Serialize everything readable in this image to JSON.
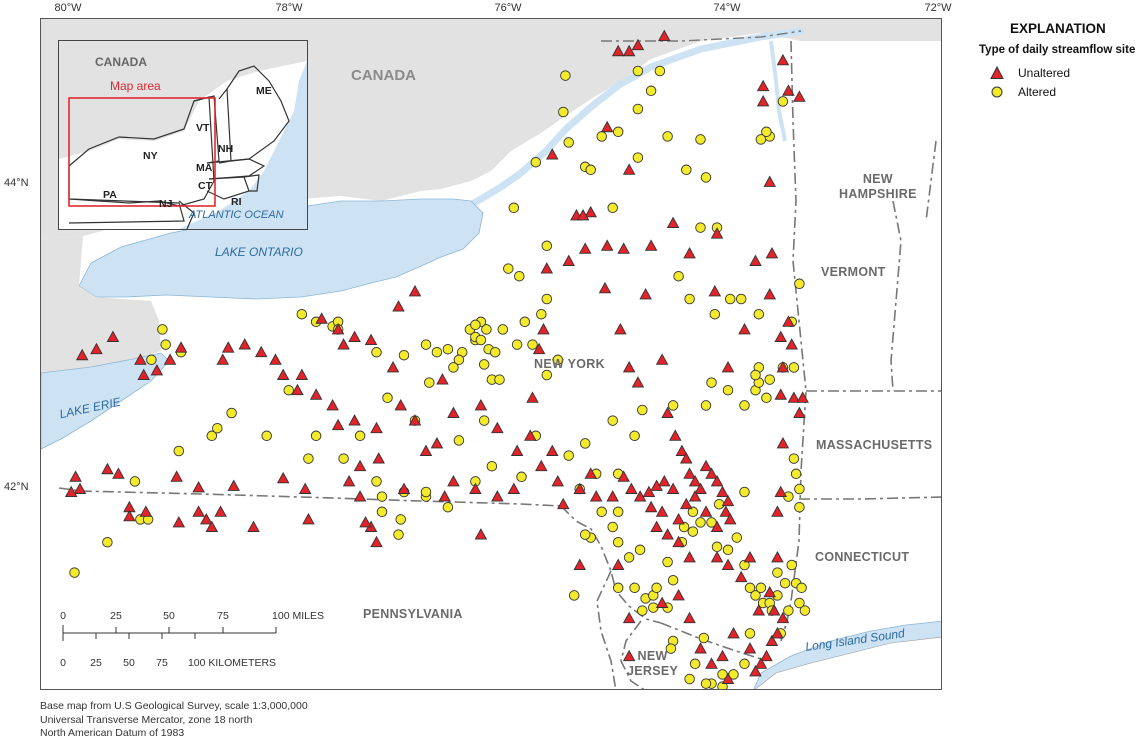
{
  "graticule": {
    "longitudes": [
      "80°W",
      "78°W",
      "76°W",
      "74°W",
      "72°W"
    ],
    "latitudes": [
      "44°N",
      "42°N"
    ]
  },
  "map_labels": {
    "canada": "CANADA",
    "new_york": "NEW YORK",
    "pennsylvania": "PENNSYLVANIA",
    "new_jersey_1": "NEW",
    "new_jersey_2": "JERSEY",
    "connecticut": "CONNECTICUT",
    "massachusetts": "MASSACHUSETTS",
    "vermont": "VERMONT",
    "new_hampshire_1": "NEW",
    "new_hampshire_2": "HAMPSHIRE",
    "lake_ontario": "LAKE ONTARIO",
    "lake_erie": "LAKE ERIE",
    "long_island_sound": "Long Island Sound"
  },
  "inset": {
    "canada": "CANADA",
    "map_area": "Map area",
    "me": "ME",
    "vt": "VT",
    "nh": "NH",
    "ny": "NY",
    "ma": "MA",
    "ct": "CT",
    "ri": "RI",
    "pa": "PA",
    "nj": "NJ",
    "ocean": "ATLANTIC OCEAN",
    "colors": {
      "map_area_box": "#e0282e"
    }
  },
  "legend": {
    "title": "EXPLANATION",
    "subtitle": "Type of daily streamflow site",
    "unaltered": "Unaltered",
    "altered": "Altered"
  },
  "scale_bar": {
    "miles_ticks": [
      "0",
      "25",
      "50",
      "75",
      "100 MILES"
    ],
    "km_ticks": [
      "0",
      "25",
      "50",
      "75",
      "100 KILOMETERS"
    ]
  },
  "credits": {
    "line1": "Base map from U.S Geological Survey, scale 1:3,000,000",
    "line2": "Universal Transverse Mercator, zone 18 north",
    "line3": "North American Datum of 1983"
  },
  "colors": {
    "water": "#cde3f4",
    "canada_land": "#e2e2e2",
    "unaltered": "#e2232a",
    "altered": "#f2ea2b",
    "marker_stroke": "#333333"
  },
  "sites": {
    "unaltered": [
      [
        -79.94,
        42.08
      ],
      [
        -79.9,
        42.0
      ],
      [
        -79.98,
        41.98
      ],
      [
        -79.65,
        42.13
      ],
      [
        -79.55,
        42.1
      ],
      [
        -79.45,
        41.88
      ],
      [
        -79.45,
        41.82
      ],
      [
        -79.3,
        41.85
      ],
      [
        -79.02,
        42.08
      ],
      [
        -79.0,
        41.78
      ],
      [
        -78.82,
        42.01
      ],
      [
        -78.82,
        41.85
      ],
      [
        -78.75,
        41.8
      ],
      [
        -78.7,
        41.75
      ],
      [
        -78.62,
        41.85
      ],
      [
        -78.5,
        42.02
      ],
      [
        -78.32,
        41.75
      ],
      [
        -78.05,
        42.07
      ],
      [
        -78.6,
        42.85
      ],
      [
        -78.55,
        42.93
      ],
      [
        -78.4,
        42.95
      ],
      [
        -78.25,
        42.9
      ],
      [
        -78.12,
        42.85
      ],
      [
        -78.05,
        42.75
      ],
      [
        -77.92,
        42.65
      ],
      [
        -77.88,
        42.75
      ],
      [
        -77.75,
        42.62
      ],
      [
        -77.6,
        42.55
      ],
      [
        -77.55,
        42.42
      ],
      [
        -77.4,
        42.45
      ],
      [
        -77.2,
        42.4
      ],
      [
        -77.18,
        42.2
      ],
      [
        -77.35,
        42.15
      ],
      [
        -77.45,
        42.05
      ],
      [
        -77.35,
        41.95
      ],
      [
        -78.98,
        42.93
      ],
      [
        -79.08,
        42.85
      ],
      [
        -79.2,
        42.78
      ],
      [
        -79.35,
        42.85
      ],
      [
        -79.32,
        42.75
      ],
      [
        -79.6,
        43.0
      ],
      [
        -79.75,
        42.92
      ],
      [
        -79.88,
        42.88
      ],
      [
        -77.7,
        43.12
      ],
      [
        -77.55,
        43.05
      ],
      [
        -77.5,
        42.95
      ],
      [
        -77.4,
        43.0
      ],
      [
        -77.25,
        42.98
      ],
      [
        -77.0,
        43.2
      ],
      [
        -76.85,
        43.3
      ],
      [
        -77.05,
        42.8
      ],
      [
        -76.98,
        42.55
      ],
      [
        -76.85,
        42.45
      ],
      [
        -76.75,
        42.25
      ],
      [
        -76.65,
        42.3
      ],
      [
        -76.5,
        42.05
      ],
      [
        -76.3,
        42.0
      ],
      [
        -76.1,
        41.95
      ],
      [
        -75.92,
        42.25
      ],
      [
        -75.8,
        42.35
      ],
      [
        -75.7,
        42.15
      ],
      [
        -75.6,
        42.25
      ],
      [
        -75.55,
        42.05
      ],
      [
        -75.5,
        41.9
      ],
      [
        -75.35,
        42.0
      ],
      [
        -75.25,
        42.1
      ],
      [
        -75.2,
        41.95
      ],
      [
        -76.6,
        42.72
      ],
      [
        -76.5,
        42.5
      ],
      [
        -76.25,
        42.55
      ],
      [
        -76.1,
        42.4
      ],
      [
        -75.95,
        42.0
      ],
      [
        -75.78,
        42.6
      ],
      [
        -75.72,
        42.92
      ],
      [
        -75.68,
        43.05
      ],
      [
        -75.65,
        43.45
      ],
      [
        -75.45,
        43.5
      ],
      [
        -75.38,
        43.8
      ],
      [
        -75.1,
        43.6
      ],
      [
        -74.95,
        43.58
      ],
      [
        -75.12,
        43.32
      ],
      [
        -74.98,
        43.05
      ],
      [
        -74.9,
        42.8
      ],
      [
        -74.82,
        42.7
      ],
      [
        -74.75,
        43.28
      ],
      [
        -74.7,
        43.6
      ],
      [
        -74.9,
        44.1
      ],
      [
        -74.5,
        43.75
      ],
      [
        -74.35,
        43.55
      ],
      [
        -74.12,
        43.3
      ],
      [
        -73.85,
        43.05
      ],
      [
        -73.75,
        43.5
      ],
      [
        -73.6,
        43.55
      ],
      [
        -74.55,
        42.5
      ],
      [
        -74.48,
        42.35
      ],
      [
        -74.42,
        42.25
      ],
      [
        -74.38,
        42.2
      ],
      [
        -74.35,
        42.1
      ],
      [
        -74.3,
        42.05
      ],
      [
        -74.25,
        42.0
      ],
      [
        -74.2,
        42.15
      ],
      [
        -74.15,
        42.1
      ],
      [
        -74.1,
        42.05
      ],
      [
        -74.05,
        41.98
      ],
      [
        -74.0,
        41.92
      ],
      [
        -74.02,
        41.85
      ],
      [
        -73.98,
        41.8
      ],
      [
        -74.1,
        41.75
      ],
      [
        -74.2,
        41.85
      ],
      [
        -74.3,
        41.95
      ],
      [
        -74.38,
        41.9
      ],
      [
        -74.45,
        41.8
      ],
      [
        -74.5,
        42.0
      ],
      [
        -74.58,
        42.05
      ],
      [
        -74.65,
        42.02
      ],
      [
        -74.72,
        41.98
      ],
      [
        -74.8,
        41.95
      ],
      [
        -74.88,
        42.0
      ],
      [
        -74.95,
        42.08
      ],
      [
        -75.05,
        41.95
      ],
      [
        -74.7,
        41.88
      ],
      [
        -74.6,
        41.85
      ],
      [
        -74.65,
        41.75
      ],
      [
        -74.55,
        41.7
      ],
      [
        -74.45,
        41.65
      ],
      [
        -74.35,
        41.55
      ],
      [
        -74.1,
        41.55
      ],
      [
        -74.0,
        41.5
      ],
      [
        -73.88,
        41.42
      ],
      [
        -73.8,
        41.55
      ],
      [
        -73.72,
        41.2
      ],
      [
        -73.6,
        41.0
      ],
      [
        -73.65,
        40.9
      ],
      [
        -73.7,
        40.85
      ],
      [
        -73.75,
        40.8
      ],
      [
        -73.8,
        40.95
      ],
      [
        -73.95,
        41.05
      ],
      [
        -74.05,
        40.9
      ],
      [
        -74.15,
        40.85
      ],
      [
        -74.25,
        40.95
      ],
      [
        -74.35,
        41.15
      ],
      [
        -74.45,
        41.3
      ],
      [
        -74.6,
        41.25
      ],
      [
        -74.9,
        41.15
      ],
      [
        -75.0,
        41.5
      ],
      [
        -75.35,
        41.5
      ],
      [
        -76.25,
        41.7
      ],
      [
        -77.2,
        41.65
      ],
      [
        -77.25,
        41.75
      ],
      [
        -77.3,
        41.78
      ],
      [
        -77.82,
        41.8
      ],
      [
        -77.85,
        42.0
      ],
      [
        -76.58,
        41.95
      ],
      [
        -76.95,
        42.0
      ],
      [
        -73.45,
        44.62
      ],
      [
        -73.35,
        44.58
      ],
      [
        -73.5,
        44.82
      ],
      [
        -73.68,
        44.65
      ],
      [
        -73.68,
        44.55
      ],
      [
        -74.9,
        44.88
      ],
      [
        -75.0,
        44.88
      ],
      [
        -74.82,
        44.92
      ],
      [
        -74.58,
        44.98
      ],
      [
        -75.1,
        44.38
      ],
      [
        -75.25,
        43.82
      ],
      [
        -75.32,
        43.8
      ],
      [
        -75.3,
        43.58
      ],
      [
        -75.6,
        44.2
      ],
      [
        -73.62,
        44.02
      ],
      [
        -73.62,
        43.28
      ],
      [
        -73.52,
        43.0
      ],
      [
        -73.42,
        42.95
      ],
      [
        -73.45,
        43.1
      ],
      [
        -73.5,
        42.8
      ],
      [
        -73.52,
        42.62
      ],
      [
        -73.4,
        42.6
      ],
      [
        -73.35,
        42.5
      ],
      [
        -73.32,
        42.6
      ],
      [
        -74.0,
        42.8
      ],
      [
        -74.6,
        42.85
      ],
      [
        -74.1,
        43.68
      ],
      [
        -73.55,
        41.85
      ],
      [
        -73.52,
        41.98
      ],
      [
        -73.5,
        42.3
      ],
      [
        -73.55,
        41.55
      ],
      [
        -73.62,
        41.32
      ],
      [
        -73.58,
        41.2
      ],
      [
        -73.55,
        41.05
      ],
      [
        -73.5,
        41.15
      ],
      [
        -74.9,
        40.9
      ],
      [
        -74.0,
        40.75
      ]
    ],
    "altered": [
      [
        -79.95,
        41.45
      ],
      [
        -79.65,
        41.65
      ],
      [
        -79.4,
        42.05
      ],
      [
        -79.35,
        41.8
      ],
      [
        -79.28,
        41.8
      ],
      [
        -79.0,
        42.25
      ],
      [
        -78.98,
        42.9
      ],
      [
        -79.12,
        42.95
      ],
      [
        -79.15,
        43.05
      ],
      [
        -79.25,
        42.85
      ],
      [
        -78.7,
        42.35
      ],
      [
        -78.52,
        42.5
      ],
      [
        -78.2,
        42.35
      ],
      [
        -78.0,
        42.65
      ],
      [
        -77.82,
        42.2
      ],
      [
        -77.75,
        42.35
      ],
      [
        -77.5,
        42.2
      ],
      [
        -77.35,
        42.35
      ],
      [
        -77.2,
        42.05
      ],
      [
        -77.15,
        41.95
      ],
      [
        -77.15,
        41.85
      ],
      [
        -76.95,
        41.98
      ],
      [
        -76.75,
        41.95
      ],
      [
        -76.75,
        41.98
      ],
      [
        -76.55,
        41.88
      ],
      [
        -76.3,
        42.05
      ],
      [
        -77.88,
        43.15
      ],
      [
        -77.75,
        43.1
      ],
      [
        -77.6,
        43.07
      ],
      [
        -77.55,
        43.1
      ],
      [
        -77.55,
        43.05
      ],
      [
        -77.2,
        42.9
      ],
      [
        -76.95,
        42.88
      ],
      [
        -76.75,
        42.95
      ],
      [
        -76.65,
        42.9
      ],
      [
        -76.55,
        42.92
      ],
      [
        -76.42,
        42.9
      ],
      [
        -76.3,
        42.98
      ],
      [
        -76.3,
        43.0
      ],
      [
        -76.35,
        43.05
      ],
      [
        -76.25,
        42.98
      ],
      [
        -76.18,
        42.92
      ],
      [
        -76.12,
        42.9
      ],
      [
        -76.2,
        43.05
      ],
      [
        -76.25,
        43.1
      ],
      [
        -76.3,
        43.08
      ],
      [
        -76.05,
        43.05
      ],
      [
        -75.92,
        42.95
      ],
      [
        -76.22,
        42.82
      ],
      [
        -76.45,
        42.85
      ],
      [
        -76.5,
        42.8
      ],
      [
        -76.15,
        42.72
      ],
      [
        -76.85,
        42.45
      ],
      [
        -77.1,
        42.6
      ],
      [
        -76.72,
        42.7
      ],
      [
        -76.08,
        42.72
      ],
      [
        -76.22,
        42.45
      ],
      [
        -76.45,
        42.32
      ],
      [
        -76.15,
        42.15
      ],
      [
        -75.88,
        42.08
      ],
      [
        -75.75,
        42.35
      ],
      [
        -75.45,
        42.22
      ],
      [
        -75.3,
        42.3
      ],
      [
        -75.05,
        42.45
      ],
      [
        -74.78,
        42.52
      ],
      [
        -74.85,
        42.35
      ],
      [
        -75.0,
        42.1
      ],
      [
        -75.2,
        42.1
      ],
      [
        -75.35,
        42.0
      ],
      [
        -75.15,
        41.85
      ],
      [
        -75.0,
        41.65
      ],
      [
        -74.9,
        41.55
      ],
      [
        -74.85,
        41.35
      ],
      [
        -74.75,
        41.28
      ],
      [
        -74.68,
        41.22
      ],
      [
        -74.55,
        41.22
      ],
      [
        -74.5,
        41.4
      ],
      [
        -74.42,
        41.65
      ],
      [
        -74.4,
        41.75
      ],
      [
        -74.32,
        41.85
      ],
      [
        -74.25,
        41.78
      ],
      [
        -74.15,
        41.78
      ],
      [
        -74.08,
        41.9
      ],
      [
        -74.0,
        41.6
      ],
      [
        -73.92,
        41.68
      ],
      [
        -73.85,
        41.5
      ],
      [
        -73.8,
        41.35
      ],
      [
        -73.75,
        41.3
      ],
      [
        -73.7,
        41.35
      ],
      [
        -73.68,
        41.25
      ],
      [
        -73.62,
        41.25
      ],
      [
        -73.6,
        41.2
      ],
      [
        -73.55,
        41.3
      ],
      [
        -73.55,
        41.45
      ],
      [
        -73.48,
        41.38
      ],
      [
        -73.45,
        41.2
      ],
      [
        -73.3,
        41.2
      ],
      [
        -73.52,
        41.05
      ],
      [
        -73.8,
        41.05
      ],
      [
        -73.85,
        40.85
      ],
      [
        -73.95,
        40.78
      ],
      [
        -74.05,
        40.78
      ],
      [
        -74.15,
        40.72
      ],
      [
        -74.2,
        40.72
      ],
      [
        -74.3,
        40.85
      ],
      [
        -74.05,
        40.7
      ],
      [
        -74.35,
        40.75
      ],
      [
        -74.5,
        41.0
      ],
      [
        -74.52,
        40.95
      ],
      [
        -74.78,
        41.2
      ],
      [
        -74.68,
        41.3
      ],
      [
        -75.0,
        41.85
      ],
      [
        -75.25,
        41.68
      ],
      [
        -75.3,
        41.7
      ],
      [
        -75.05,
        41.75
      ],
      [
        -75.65,
        42.75
      ],
      [
        -75.85,
        43.1
      ],
      [
        -75.65,
        43.25
      ],
      [
        -75.9,
        43.4
      ],
      [
        -75.65,
        43.6
      ],
      [
        -75.05,
        43.85
      ],
      [
        -74.82,
        44.18
      ],
      [
        -74.82,
        44.5
      ],
      [
        -74.82,
        44.75
      ],
      [
        -74.62,
        44.75
      ],
      [
        -74.55,
        44.32
      ],
      [
        -74.38,
        44.1
      ],
      [
        -74.2,
        44.05
      ],
      [
        -74.1,
        43.72
      ],
      [
        -74.45,
        43.4
      ],
      [
        -74.25,
        43.72
      ],
      [
        -74.35,
        43.25
      ],
      [
        -74.12,
        43.15
      ],
      [
        -73.98,
        43.25
      ],
      [
        -73.88,
        43.25
      ],
      [
        -73.72,
        43.15
      ],
      [
        -73.72,
        42.8
      ],
      [
        -73.75,
        42.65
      ],
      [
        -73.62,
        42.72
      ],
      [
        -73.72,
        42.7
      ],
      [
        -73.75,
        42.75
      ],
      [
        -73.65,
        42.6
      ],
      [
        -73.5,
        42.8
      ],
      [
        -73.85,
        42.55
      ],
      [
        -74.0,
        42.65
      ],
      [
        -74.15,
        42.7
      ],
      [
        -74.2,
        42.55
      ],
      [
        -74.5,
        42.55
      ],
      [
        -73.62,
        44.32
      ],
      [
        -73.65,
        44.35
      ],
      [
        -73.7,
        44.3
      ],
      [
        -73.5,
        44.55
      ],
      [
        -75.0,
        44.35
      ],
      [
        -75.15,
        44.32
      ],
      [
        -75.45,
        44.28
      ],
      [
        -75.5,
        44.48
      ],
      [
        -75.48,
        44.72
      ],
      [
        -75.3,
        44.12
      ],
      [
        -75.25,
        44.1
      ],
      [
        -75.75,
        44.15
      ],
      [
        -75.95,
        43.85
      ],
      [
        -76.0,
        43.45
      ],
      [
        -75.7,
        43.15
      ],
      [
        -75.55,
        42.85
      ],
      [
        -75.78,
        42.95
      ],
      [
        -73.35,
        43.35
      ],
      [
        -73.42,
        43.1
      ],
      [
        -73.4,
        42.8
      ],
      [
        -73.4,
        42.2
      ],
      [
        -73.38,
        42.1
      ],
      [
        -73.35,
        42.0
      ],
      [
        -73.35,
        41.88
      ],
      [
        -73.85,
        41.98
      ],
      [
        -73.45,
        41.95
      ],
      [
        -73.42,
        41.5
      ],
      [
        -73.38,
        41.38
      ],
      [
        -73.33,
        41.35
      ],
      [
        -73.35,
        41.25
      ],
      [
        -74.22,
        41.02
      ],
      [
        -74.1,
        41.62
      ],
      [
        -74.32,
        41.72
      ],
      [
        -74.55,
        41.52
      ],
      [
        -74.65,
        41.35
      ],
      [
        -74.8,
        41.6
      ],
      [
        -75.0,
        41.35
      ],
      [
        -75.4,
        41.3
      ],
      [
        -76.98,
        41.8
      ],
      [
        -77.0,
        41.7
      ],
      [
        -78.65,
        42.4
      ],
      [
        -74.25,
        44.3
      ],
      [
        -74.7,
        44.62
      ]
    ]
  }
}
